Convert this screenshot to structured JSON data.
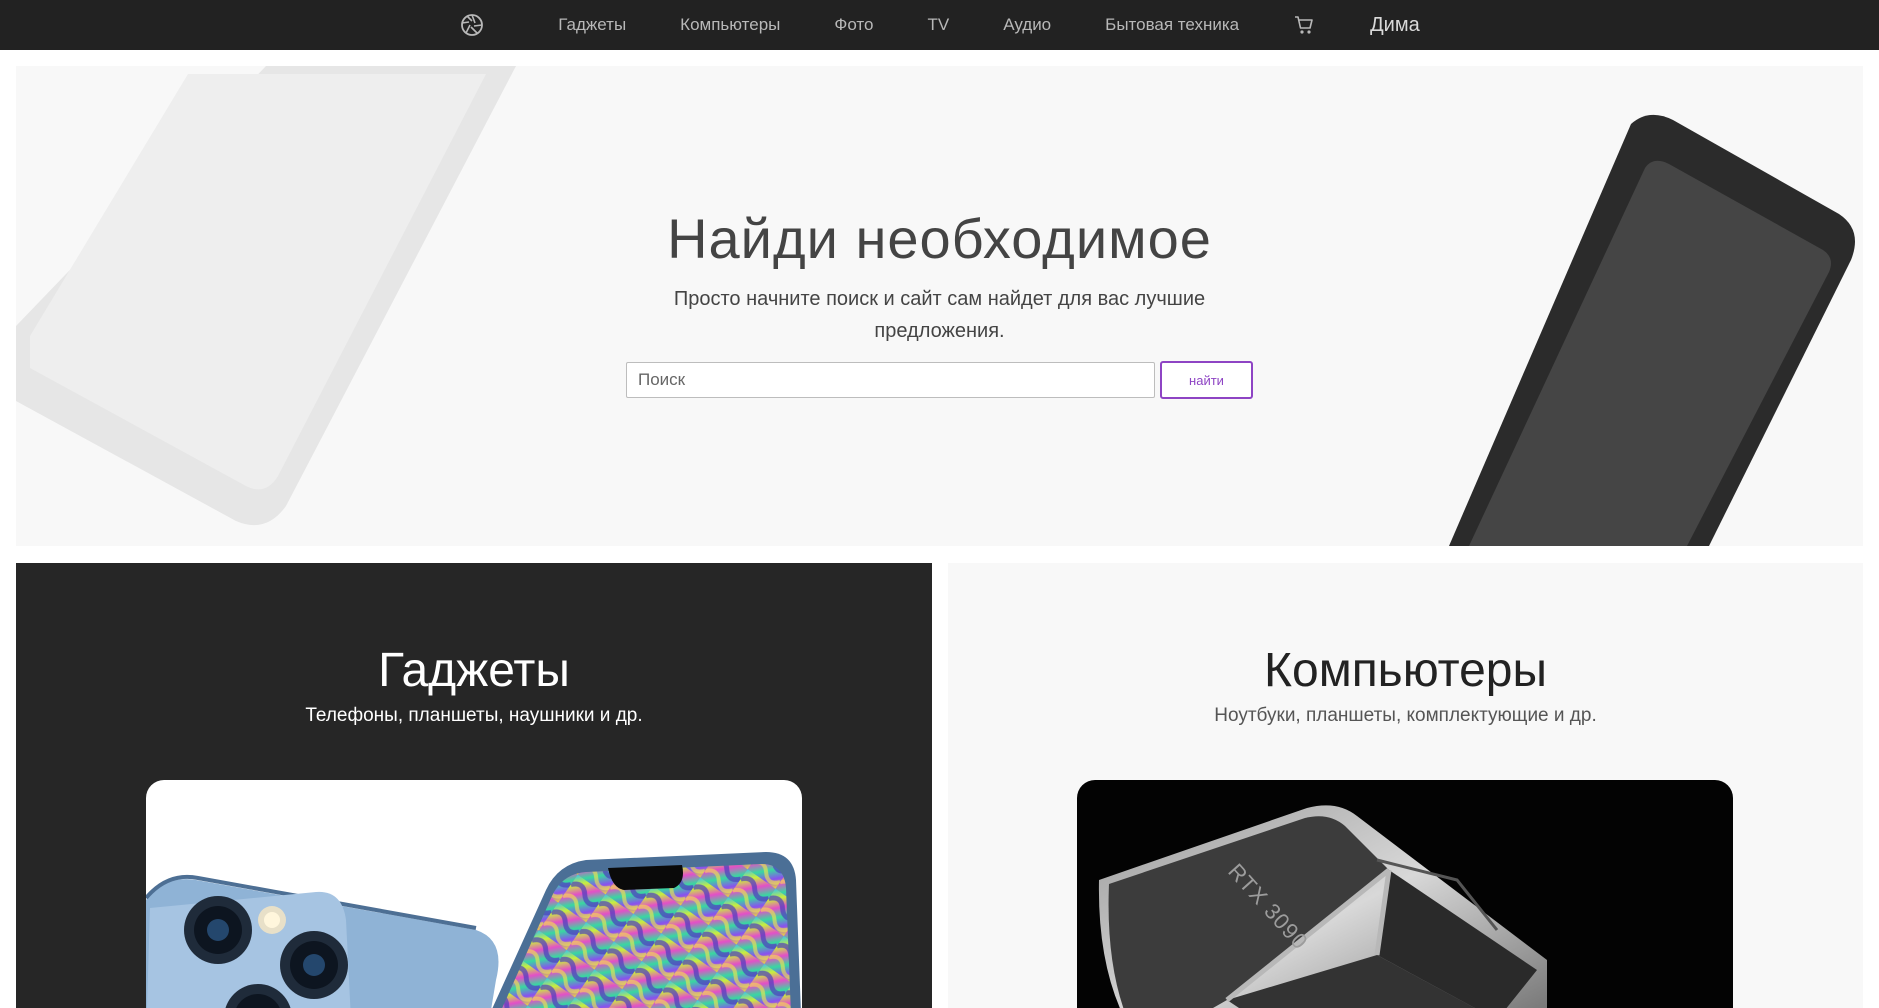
{
  "nav": {
    "logo_icon": "aperture-icon",
    "links": [
      "Гаджеты",
      "Компьютеры",
      "Фото",
      "TV",
      "Аудио",
      "Бытовая техника"
    ],
    "cart_icon": "cart-icon",
    "user_name": "Дима"
  },
  "hero": {
    "title": "Найди необходимое",
    "subtitle": "Просто начните поиск и сайт сам найдет для вас лучшие предложения.",
    "search_placeholder": "Поиск",
    "search_button": "найти"
  },
  "categories": [
    {
      "title": "Гаджеты",
      "subtitle": "Телефоны, планшеты, наушники и др.",
      "image": "smartphones-image"
    },
    {
      "title": "Компьютеры",
      "subtitle": "Ноутбуки, планшеты, комплектующие и др.",
      "image": "graphics-card-image",
      "image_text": "RTX 3090"
    }
  ],
  "colors": {
    "navbar_bg": "#222222",
    "accent": "#8e44c4",
    "dark_panel": "#262626",
    "light_panel": "#f8f8f8"
  }
}
